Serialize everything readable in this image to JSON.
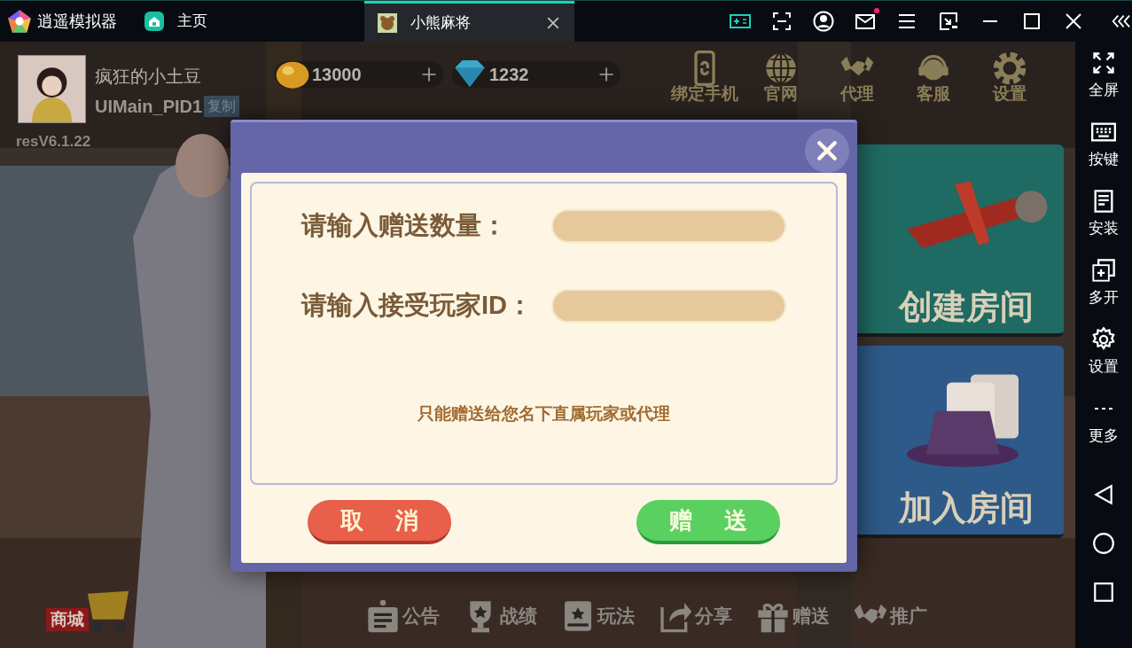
{
  "emulator": {
    "brand": "逍遥模拟器",
    "mail_unread": true,
    "tabs": [
      {
        "label": "主页",
        "selected": false,
        "closable": false
      },
      {
        "label": "小熊麻将",
        "selected": true,
        "closable": true
      }
    ],
    "sidebar": [
      {
        "label": "全屏"
      },
      {
        "label": "按键"
      },
      {
        "label": "安装"
      },
      {
        "label": "多开"
      },
      {
        "label": "设置"
      },
      {
        "label": "更多"
      }
    ]
  },
  "game": {
    "player": {
      "name": "疯狂的小土豆",
      "id": "UIMain_PID1",
      "copy_label": "复制",
      "version": "resV6.1.22"
    },
    "currencies": [
      {
        "kind": "bean",
        "amount": "13000"
      },
      {
        "kind": "diamond",
        "amount": "1232"
      }
    ],
    "top_menu": [
      "绑定手机",
      "官网",
      "代理",
      "客服",
      "设置"
    ],
    "room_cards": [
      {
        "kind": "create",
        "label": "创建房间"
      },
      {
        "kind": "join",
        "label": "加入房间"
      }
    ],
    "shop_label": "商城",
    "bottom_menu": [
      "公告",
      "战绩",
      "玩法",
      "分享",
      "赠送",
      "推广"
    ]
  },
  "dialog": {
    "fields": [
      {
        "label": "请输入赠送数量："
      },
      {
        "label": "请输入接受玩家ID："
      }
    ],
    "note": "只能赠送给您名下直属玩家或代理",
    "buttons": [
      {
        "kind": "cancel",
        "label": "取消"
      },
      {
        "kind": "confirm",
        "label": "赠送"
      }
    ]
  }
}
